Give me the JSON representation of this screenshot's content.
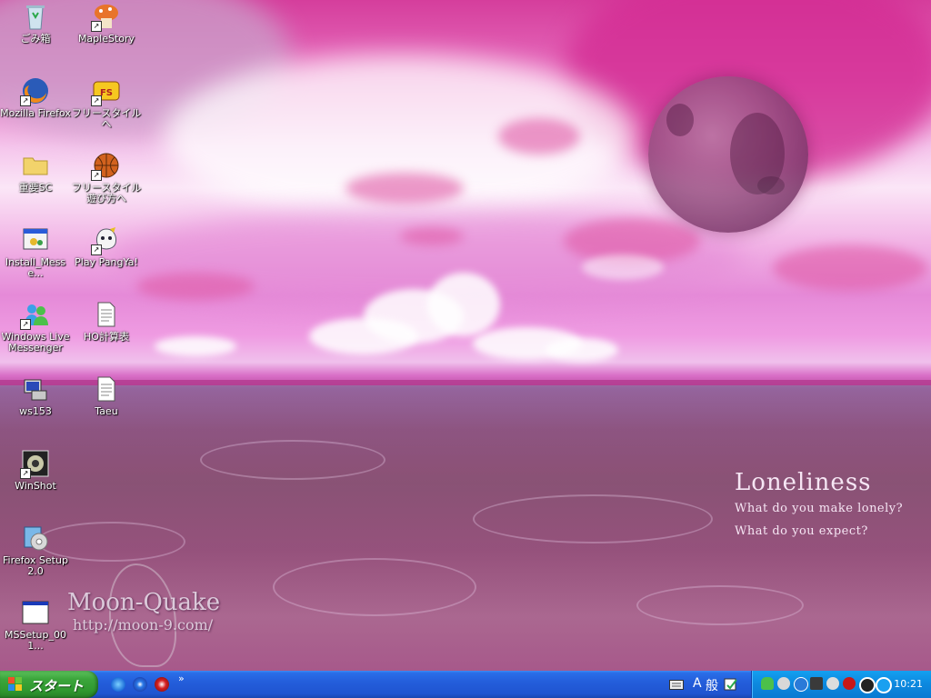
{
  "desktop": {
    "icons": [
      {
        "label": "ごみ箱",
        "icon": "recycle-bin-icon"
      },
      {
        "label": "MapleStory",
        "icon": "maplestory-icon"
      },
      {
        "label": "Mozilla Firefox",
        "icon": "firefox-icon"
      },
      {
        "label": "フリースタイルへ",
        "icon": "freestyle-icon"
      },
      {
        "label": "重要SC",
        "icon": "folder-icon"
      },
      {
        "label": "フリースタイル遊び方へ",
        "icon": "basketball-icon"
      },
      {
        "label": "Install_Messe...",
        "icon": "installer-icon"
      },
      {
        "label": "Play PangYa!",
        "icon": "pangya-icon"
      },
      {
        "label": "Windows Live Messenger",
        "icon": "messenger-icon"
      },
      {
        "label": "HO計算表",
        "icon": "text-file-icon"
      },
      {
        "label": "ws153",
        "icon": "ws153-icon"
      },
      {
        "label": "Taeu",
        "icon": "text-file-icon"
      },
      {
        "label": "WinShot",
        "icon": "winshot-icon"
      },
      {
        "label": "Firefox Setup 2.0",
        "icon": "setup-icon"
      },
      {
        "label": "MSSetup_001...",
        "icon": "window-app-icon"
      }
    ]
  },
  "wallpaper": {
    "title": "Loneliness",
    "line1": "What do you make lonely?",
    "line2": "What do you expect?",
    "brand_name": "Moon-Quake",
    "brand_url": "http://moon-9.com/"
  },
  "taskbar": {
    "start_label": "スタート",
    "quick_launch": [
      "ie-icon",
      "media-player-icon",
      "antivirus-icon"
    ],
    "quick_launch_more": "»",
    "language_bar": {
      "mode": "A",
      "ime": "般"
    },
    "tray_icons": [
      "messenger-tray-icon",
      "volume-icon",
      "info-icon",
      "monitor-icon",
      "antivirus-tray-icon",
      "security-icon",
      "network-icon",
      "update-icon"
    ],
    "clock": "10:21",
    "colors": {
      "taskbar": "#245edb",
      "start": "#3ca63c",
      "tray": "#0d8ae0"
    }
  }
}
